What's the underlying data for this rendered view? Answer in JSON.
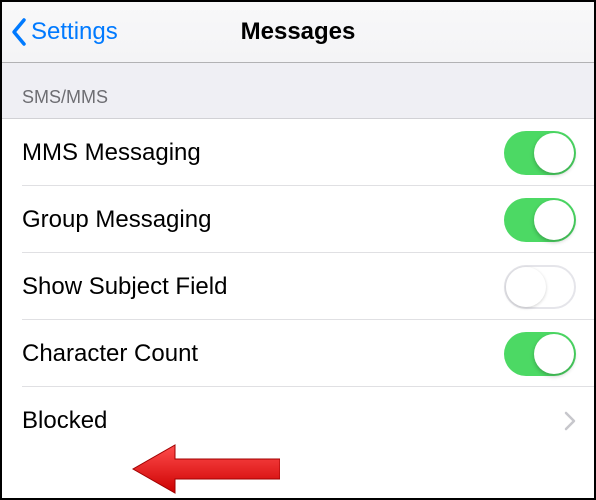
{
  "nav": {
    "back_label": "Settings",
    "title": "Messages"
  },
  "section": {
    "header": "SMS/MMS"
  },
  "rows": {
    "mms": {
      "label": "MMS Messaging",
      "enabled": true
    },
    "group": {
      "label": "Group Messaging",
      "enabled": true
    },
    "subject": {
      "label": "Show Subject Field",
      "enabled": false
    },
    "chars": {
      "label": "Character Count",
      "enabled": true
    },
    "blocked": {
      "label": "Blocked"
    }
  },
  "colors": {
    "accent": "#007aff",
    "switch_on": "#4cd964",
    "arrow": "#ff0000"
  }
}
